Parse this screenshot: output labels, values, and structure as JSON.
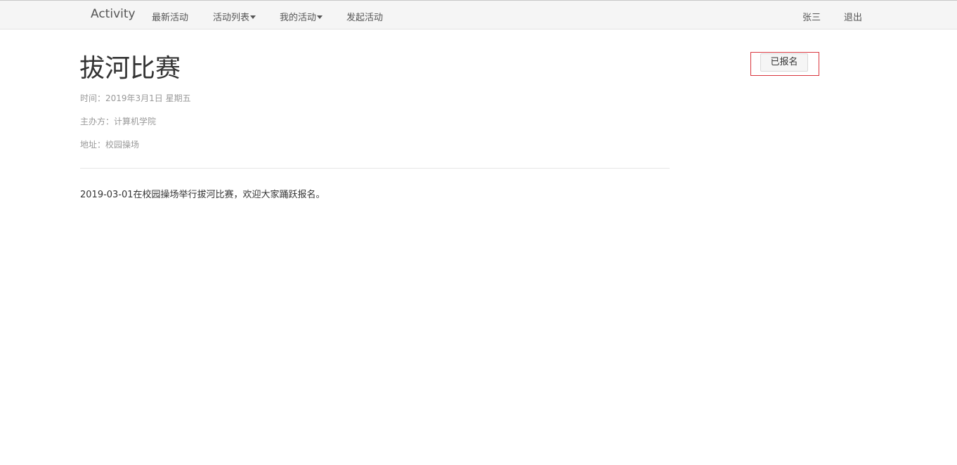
{
  "navbar": {
    "brand": "Activity",
    "items": [
      {
        "label": "最新活动",
        "has_caret": false
      },
      {
        "label": "活动列表",
        "has_caret": true
      },
      {
        "label": "我的活动",
        "has_caret": true
      },
      {
        "label": "发起活动",
        "has_caret": false
      }
    ],
    "user_name": "张三",
    "logout_label": "退出"
  },
  "activity": {
    "title": "拔河比赛",
    "time": "时间：2019年3月1日 星期五",
    "organizer": "主办方：计算机学院",
    "address": "地址：校园操场",
    "description": "2019-03-01在校园操场举行拔河比赛，欢迎大家踊跃报名。",
    "enroll_status_label": "已报名"
  },
  "colors": {
    "navbar_bg": "#f5f5f5",
    "highlight_border": "#d9363e",
    "meta_text": "#999999"
  },
  "icons": {
    "dropdown_caret": "caret-down-icon"
  }
}
